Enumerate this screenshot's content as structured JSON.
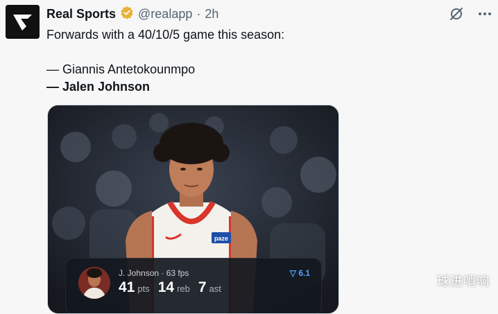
{
  "author": {
    "name": "Real Sports",
    "handle": "@realapp",
    "separator": "·",
    "time": "2h"
  },
  "tweet": {
    "line1": "Forwards with a 40/10/5 game this season:",
    "line2": "— Giannis Antetokounmpo",
    "line3": "— Jalen Johnson"
  },
  "media": {
    "jersey_sponsor": "paze",
    "card": {
      "player_line": "J. Johnson · 63 fps",
      "score": "6.1",
      "pts": "41",
      "pts_label": "pts",
      "reb": "14",
      "reb_label": "reb",
      "ast": "7",
      "ast_label": "ast"
    }
  },
  "watermark": "球进哨响",
  "icons": [
    "grok-icon",
    "more-icon",
    "verified-icon"
  ],
  "colors": {
    "verified": "#E8B23A",
    "accent_blue": "#4da3ff",
    "jersey_red": "#d9352b"
  }
}
